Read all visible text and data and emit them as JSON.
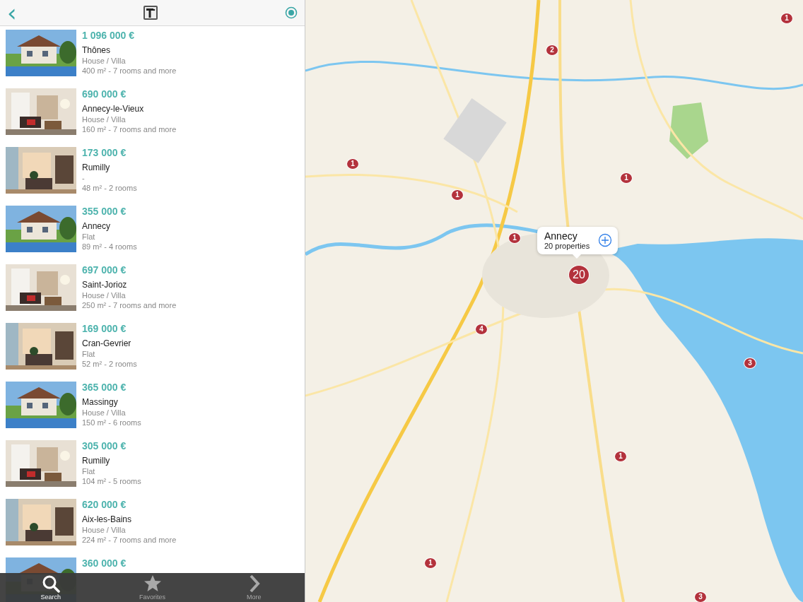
{
  "header": {
    "back": "‹"
  },
  "listings": [
    {
      "price": "1 096 000 €",
      "town": "Thônes",
      "type": "House / Villa",
      "details": "400 m² - 7 rooms and more"
    },
    {
      "price": "690 000 €",
      "town": "Annecy-le-Vieux",
      "type": "House / Villa",
      "details": "160 m² - 7 rooms and more"
    },
    {
      "price": "173 000 €",
      "town": "Rumilly",
      "type": "-",
      "details": "48 m² - 2 rooms"
    },
    {
      "price": "355 000 €",
      "town": "Annecy",
      "type": "Flat",
      "details": "89 m² - 4 rooms"
    },
    {
      "price": "697 000 €",
      "town": "Saint-Jorioz",
      "type": "House / Villa",
      "details": "250 m² - 7 rooms and more"
    },
    {
      "price": "169 000 €",
      "town": "Cran-Gevrier",
      "type": "Flat",
      "details": "52 m² - 2 rooms"
    },
    {
      "price": "365 000 €",
      "town": "Massingy",
      "type": "House / Villa",
      "details": "150 m² - 6 rooms"
    },
    {
      "price": "305 000 €",
      "town": "Rumilly",
      "type": "Flat",
      "details": "104 m² - 5 rooms"
    },
    {
      "price": "620 000 €",
      "town": "Aix-les-Bains",
      "type": "House / Villa",
      "details": "224 m² - 7 rooms and more"
    },
    {
      "price": "360 000 €"
    }
  ],
  "tabs": [
    {
      "label": "Search",
      "kind": "search",
      "selected": true
    },
    {
      "label": "Favorites",
      "kind": "star",
      "selected": false
    },
    {
      "label": "More",
      "kind": "more",
      "selected": false
    }
  ],
  "map": {
    "pins": [
      "1",
      "2",
      "1",
      "1",
      "1",
      "1",
      "20",
      "4",
      "3",
      "1",
      "1",
      "3"
    ],
    "callout": {
      "title": "Annecy",
      "subtitle": "20 properties"
    }
  }
}
